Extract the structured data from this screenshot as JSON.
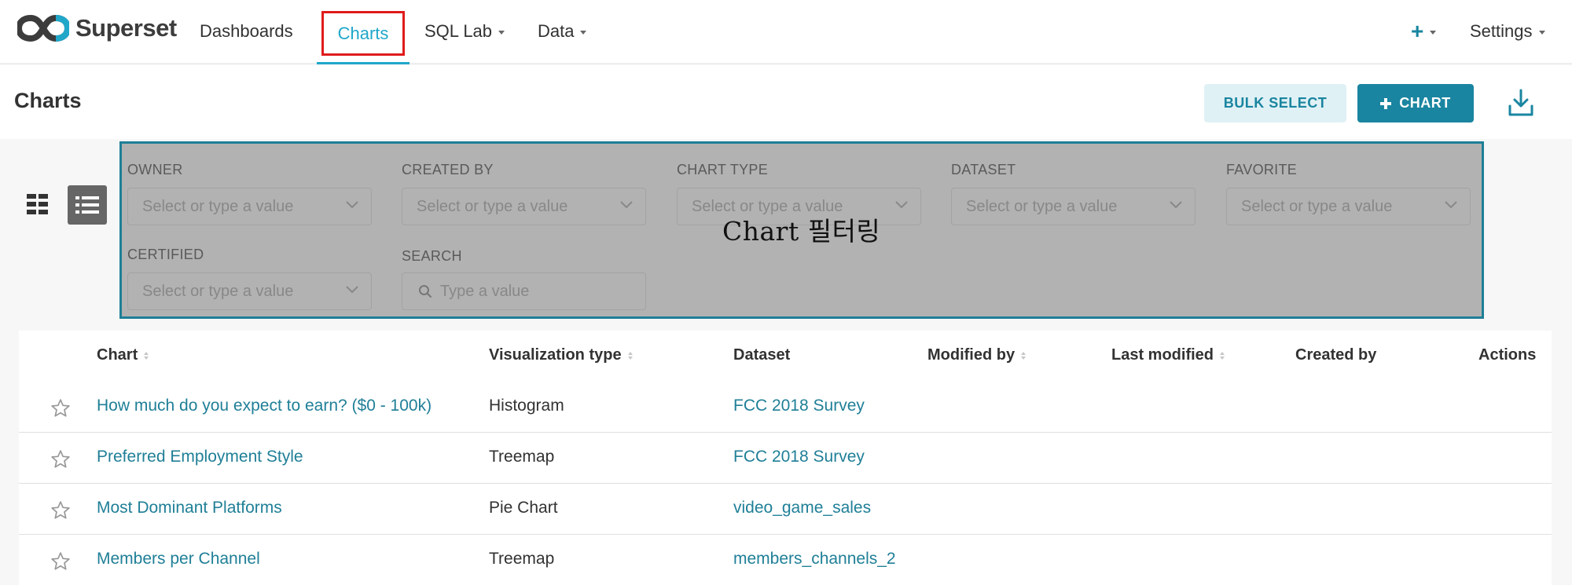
{
  "app": {
    "name": "Superset"
  },
  "nav": {
    "items": [
      {
        "label": "Dashboards"
      },
      {
        "label": "Charts",
        "active": true
      },
      {
        "label": "SQL Lab"
      },
      {
        "label": "Data"
      }
    ],
    "plus_label": "+",
    "settings_label": "Settings"
  },
  "page": {
    "title": "Charts",
    "bulk_select_label": "BULK SELECT",
    "add_chart_label": "CHART"
  },
  "filters": {
    "owner": {
      "label": "OWNER",
      "placeholder": "Select or type a value"
    },
    "created_by": {
      "label": "CREATED BY",
      "placeholder": "Select or type a value"
    },
    "chart_type": {
      "label": "CHART TYPE",
      "placeholder": "Select or type a value"
    },
    "dataset": {
      "label": "DATASET",
      "placeholder": "Select or type a value"
    },
    "favorite": {
      "label": "FAVORITE",
      "placeholder": "Select or type a value"
    },
    "certified": {
      "label": "CERTIFIED",
      "placeholder": "Select or type a value"
    },
    "search": {
      "label": "SEARCH",
      "placeholder": "Type a value"
    },
    "overlay_caption": "Chart 필터링"
  },
  "table": {
    "columns": [
      "Chart",
      "Visualization type",
      "Dataset",
      "Modified by",
      "Last modified",
      "Created by",
      "Actions"
    ],
    "rows": [
      {
        "chart": "How much do you expect to earn? ($0 - 100k)",
        "viz": "Histogram",
        "dataset": "FCC 2018 Survey"
      },
      {
        "chart": "Preferred Employment Style",
        "viz": "Treemap",
        "dataset": "FCC 2018 Survey"
      },
      {
        "chart": "Most Dominant Platforms",
        "viz": "Pie Chart",
        "dataset": "video_game_sales"
      },
      {
        "chart": "Members per Channel",
        "viz": "Treemap",
        "dataset": "members_channels_2"
      }
    ]
  },
  "colors": {
    "accent": "#20a7c9",
    "primary_button": "#1a85a0",
    "highlight_box": "#e01b1b",
    "overlay": "#b2b2b2"
  }
}
